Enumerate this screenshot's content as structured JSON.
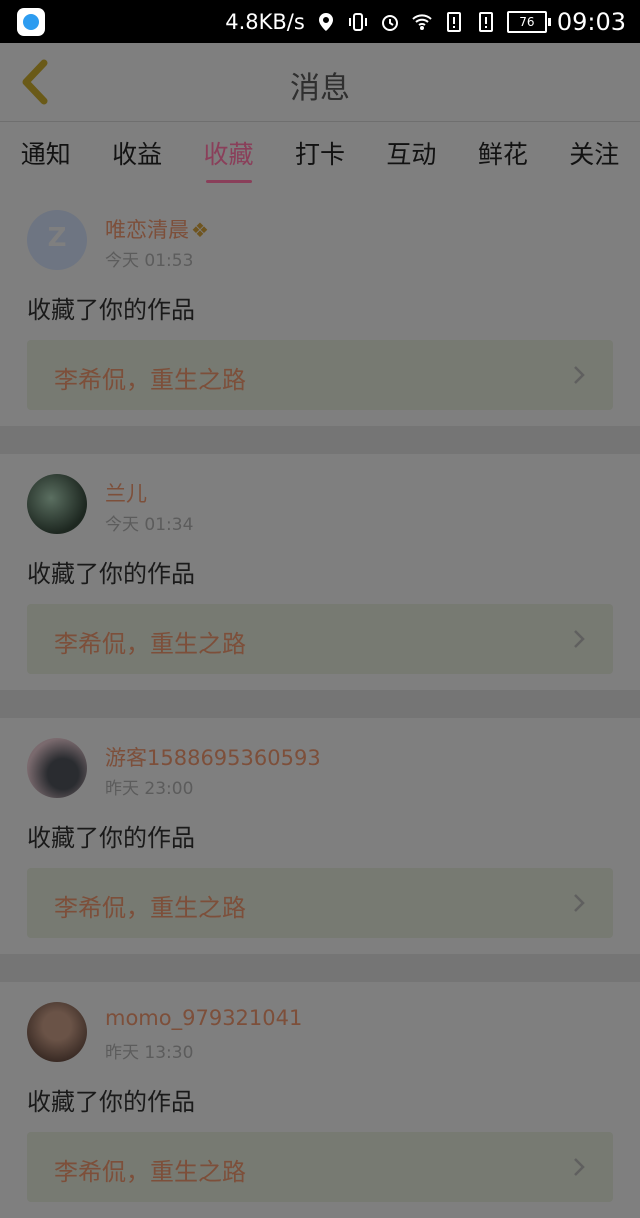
{
  "status_bar": {
    "net_speed": "4.8KB/s",
    "battery": "76",
    "time": "09:03"
  },
  "header": {
    "title": "消息"
  },
  "tabs": [
    {
      "label": "通知"
    },
    {
      "label": "收益"
    },
    {
      "label": "收藏",
      "active": true
    },
    {
      "label": "打卡"
    },
    {
      "label": "互动"
    },
    {
      "label": "鲜花"
    },
    {
      "label": "关注"
    }
  ],
  "items": [
    {
      "user": "唯恋清晨",
      "time": "今天 01:53",
      "action": "收藏了你的作品",
      "work": "李希侃，重生之路"
    },
    {
      "user": "兰儿",
      "time": "今天 01:34",
      "action": "收藏了你的作品",
      "work": "李希侃，重生之路"
    },
    {
      "user": "游客1588695360593",
      "time": "昨天 23:00",
      "action": "收藏了你的作品",
      "work": "李希侃，重生之路"
    },
    {
      "user": "momo_979321041",
      "time": "昨天 13:30",
      "action": "收藏了你的作品",
      "work": "李希侃，重生之路"
    }
  ],
  "colors": {
    "accent": "#8a3f5a",
    "username": "#7d4f3a"
  }
}
